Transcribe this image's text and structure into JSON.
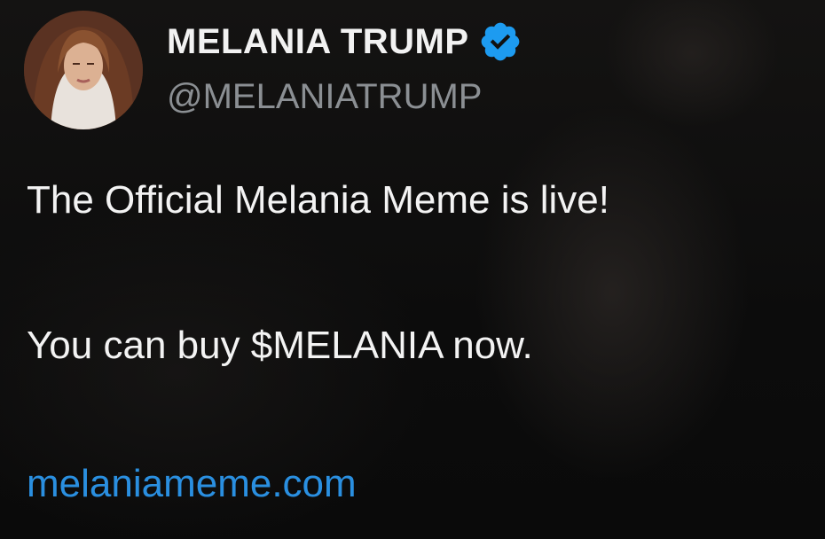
{
  "author": {
    "display_name": "MELANIA TRUMP",
    "handle": "@MELANIATRUMP",
    "verified_icon": "verified-badge-icon",
    "verified_color": "#1d9bf0"
  },
  "tweet": {
    "lines": [
      "The Official Melania Meme is live!",
      "You can buy $MELANIA now."
    ],
    "link_text": "melaniameme.com",
    "link_color": "#2a8fe0"
  }
}
